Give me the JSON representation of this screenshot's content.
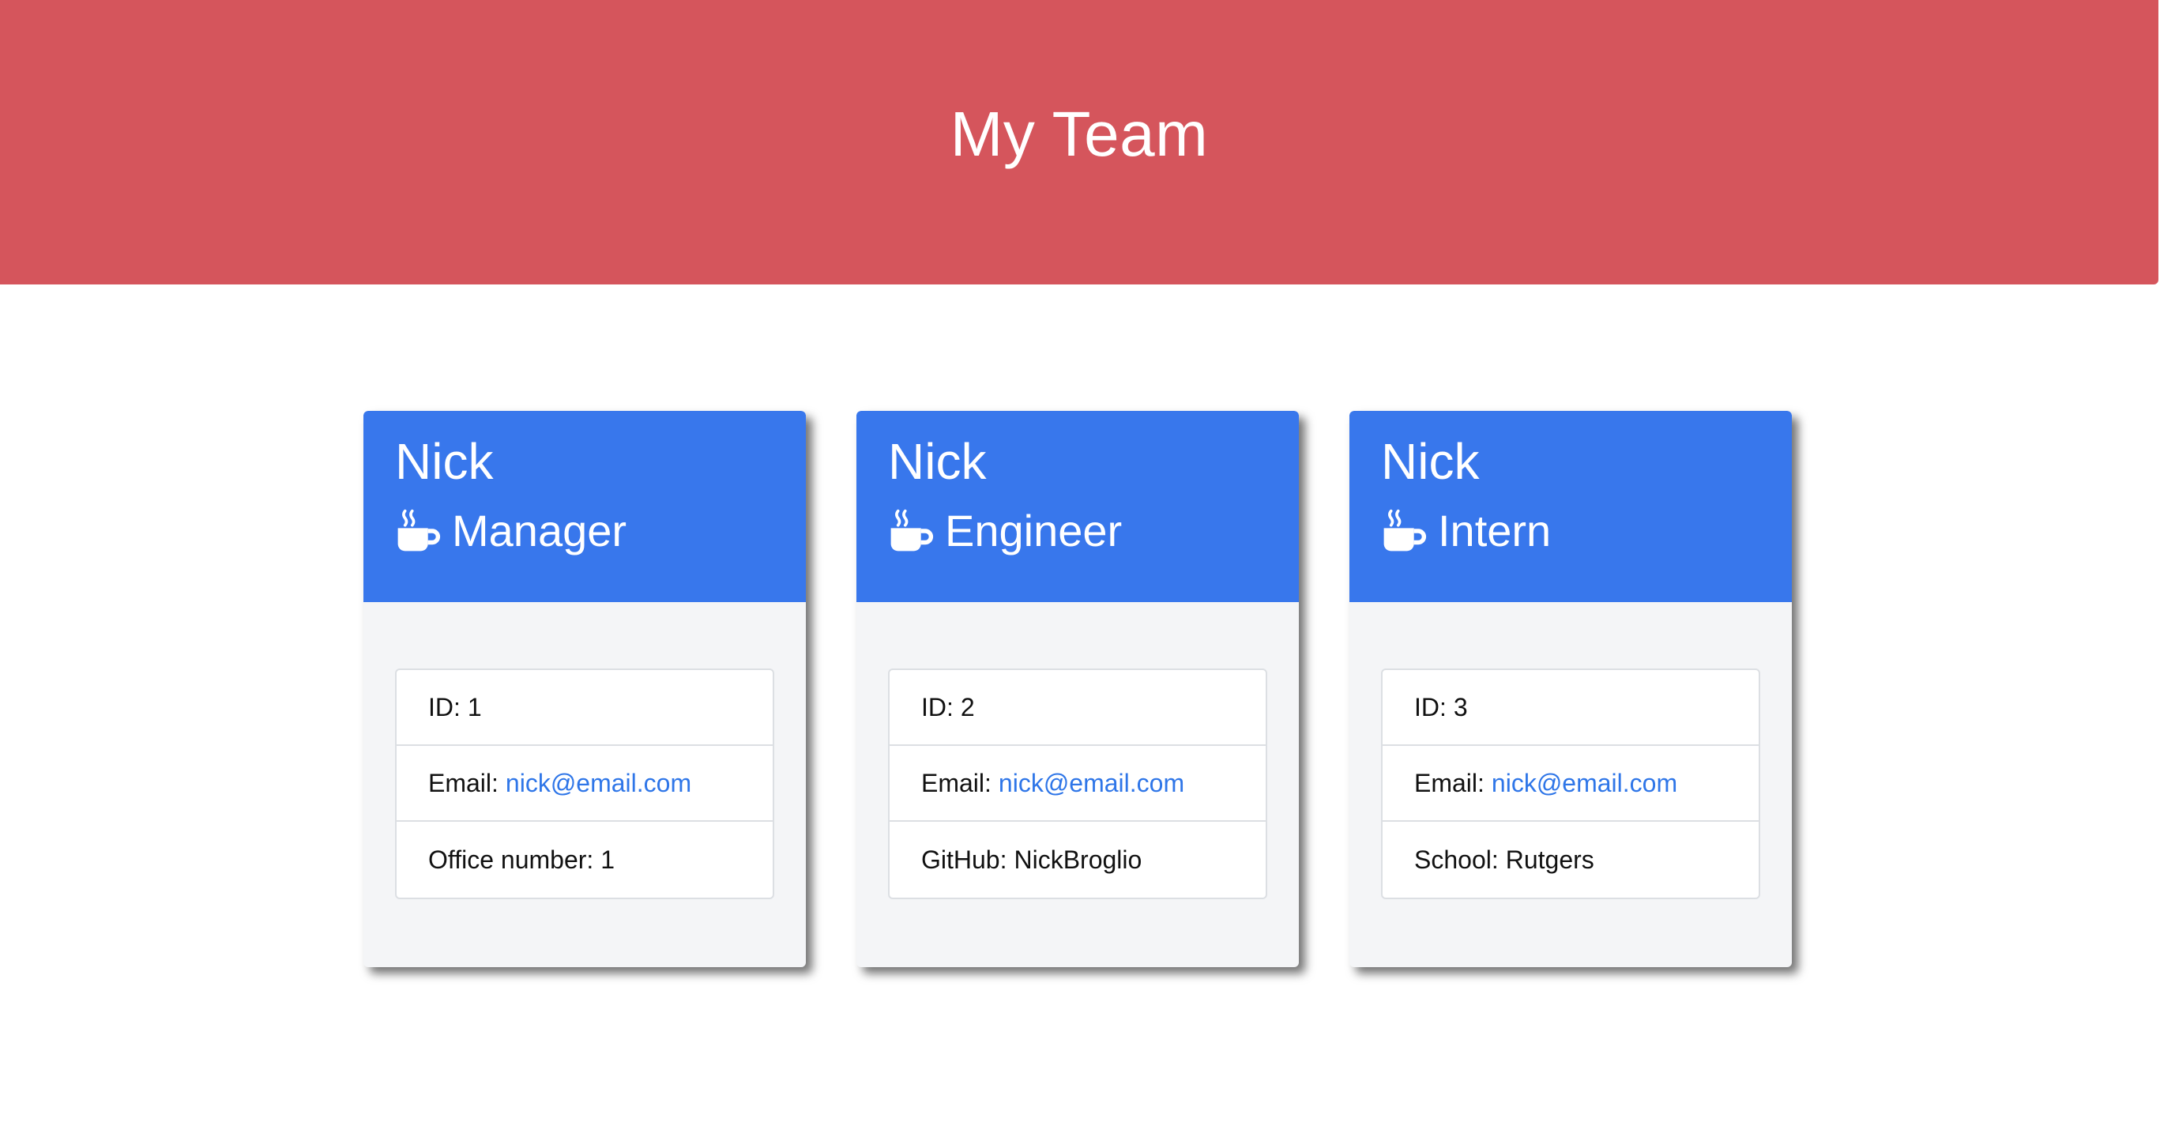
{
  "header": {
    "title": "My Team",
    "color": "#d5555c"
  },
  "accent": "#3877ec",
  "link_color": "#2f76e8",
  "cards": [
    {
      "name": "Nick",
      "role": "Manager",
      "role_icon": "coffee-mug-icon",
      "id_label": "ID:",
      "id_value": "1",
      "email_label": "Email:",
      "email": "nick@email.com",
      "extra_label": "Office number:",
      "extra_value": "1"
    },
    {
      "name": "Nick",
      "role": "Engineer",
      "role_icon": "coffee-mug-icon",
      "id_label": "ID:",
      "id_value": "2",
      "email_label": "Email:",
      "email": "nick@email.com",
      "extra_label": "GitHub:",
      "extra_value": "NickBroglio"
    },
    {
      "name": "Nick",
      "role": "Intern",
      "role_icon": "coffee-mug-icon",
      "id_label": "ID:",
      "id_value": "3",
      "email_label": "Email:",
      "email": "nick@email.com",
      "extra_label": "School:",
      "extra_value": "Rutgers"
    }
  ]
}
